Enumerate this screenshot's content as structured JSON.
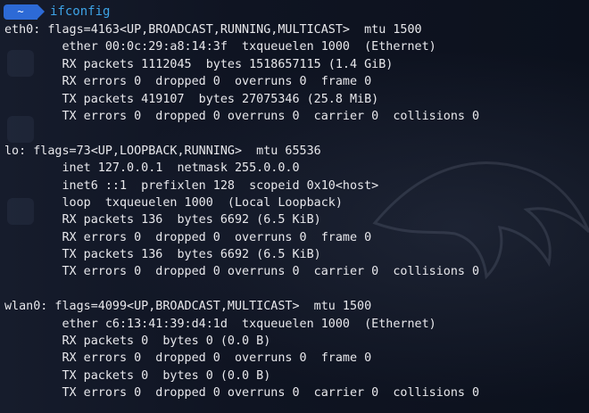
{
  "prompt": {
    "badge_icon": "~",
    "command": "ifconfig"
  },
  "output_lines": [
    "eth0: flags=4163<UP,BROADCAST,RUNNING,MULTICAST>  mtu 1500",
    "        ether 00:0c:29:a8:14:3f  txqueuelen 1000  (Ethernet)",
    "        RX packets 1112045  bytes 1518657115 (1.4 GiB)",
    "        RX errors 0  dropped 0  overruns 0  frame 0",
    "        TX packets 419107  bytes 27075346 (25.8 MiB)",
    "        TX errors 0  dropped 0 overruns 0  carrier 0  collisions 0",
    "",
    "lo: flags=73<UP,LOOPBACK,RUNNING>  mtu 65536",
    "        inet 127.0.0.1  netmask 255.0.0.0",
    "        inet6 ::1  prefixlen 128  scopeid 0x10<host>",
    "        loop  txqueuelen 1000  (Local Loopback)",
    "        RX packets 136  bytes 6692 (6.5 KiB)",
    "        RX errors 0  dropped 0  overruns 0  frame 0",
    "        TX packets 136  bytes 6692 (6.5 KiB)",
    "        TX errors 0  dropped 0 overruns 0  carrier 0  collisions 0",
    "",
    "wlan0: flags=4099<UP,BROADCAST,MULTICAST>  mtu 1500",
    "        ether c6:13:41:39:d4:1d  txqueuelen 1000  (Ethernet)",
    "        RX packets 0  bytes 0 (0.0 B)",
    "        RX errors 0  dropped 0  overruns 0  frame 0",
    "        TX packets 0  bytes 0 (0.0 B)",
    "        TX errors 0  dropped 0 overruns 0  carrier 0  collisions 0"
  ],
  "colors": {
    "background": "#0f1422",
    "prompt_badge": "#2d6ad6",
    "command": "#3da3e6",
    "output_text": "#e8e8ec"
  }
}
